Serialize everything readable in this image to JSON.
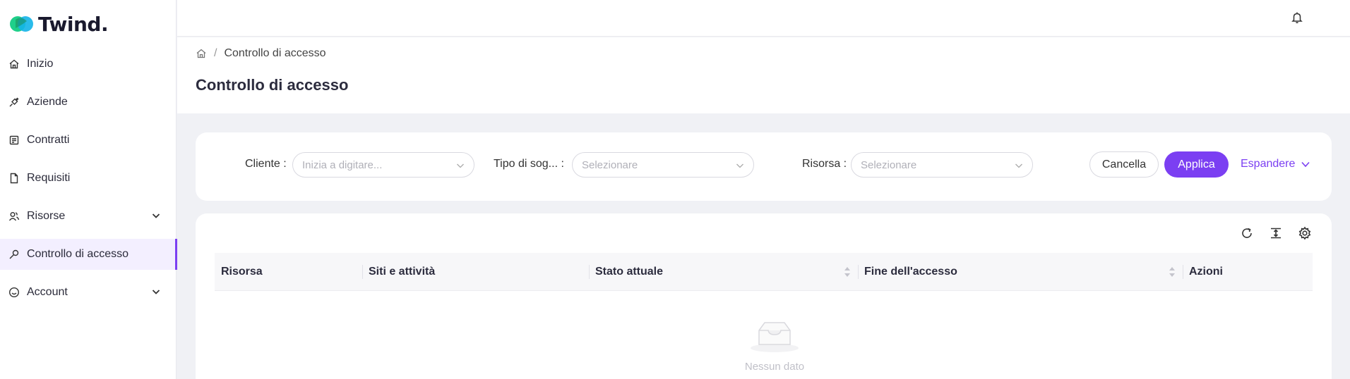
{
  "app": {
    "logo_text": "Twind.",
    "brand_color": "#7b3ff2"
  },
  "sidebar": {
    "items": [
      {
        "label": "Inizio",
        "icon": "home-icon"
      },
      {
        "label": "Aziende",
        "icon": "plug-icon"
      },
      {
        "label": "Contratti",
        "icon": "contract-icon"
      },
      {
        "label": "Requisiti",
        "icon": "document-icon"
      },
      {
        "label": "Risorse",
        "icon": "users-icon",
        "expandable": true
      },
      {
        "label": "Controllo di accesso",
        "icon": "key-icon",
        "active": true
      },
      {
        "label": "Account",
        "icon": "smile-icon",
        "expandable": true
      }
    ]
  },
  "breadcrumb": {
    "current": "Controllo di accesso"
  },
  "page": {
    "title": "Controllo di accesso"
  },
  "filters": {
    "cliente": {
      "label": "Cliente",
      "placeholder": "Inizia a digitare..."
    },
    "tipo": {
      "label": "Tipo di sog...",
      "placeholder": "Selezionare"
    },
    "risorsa": {
      "label": "Risorsa",
      "placeholder": "Selezionare"
    },
    "cancel_label": "Cancella",
    "apply_label": "Applica",
    "expand_label": "Espandere"
  },
  "table": {
    "columns": [
      "Risorsa",
      "Siti e attività",
      "Stato attuale",
      "Fine dell'accesso",
      "Azioni"
    ],
    "empty_text": "Nessun dato"
  }
}
